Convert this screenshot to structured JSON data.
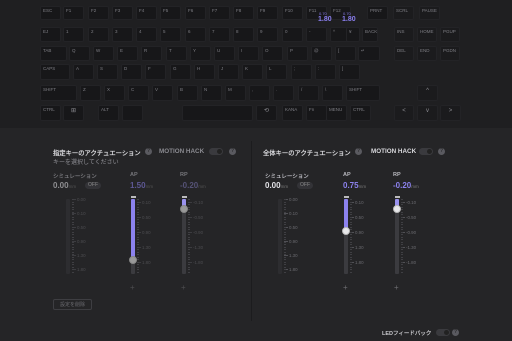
{
  "keyboard": {
    "rows": [
      [
        [
          "ESC",
          0
        ],
        [
          "F1",
          0
        ],
        [
          "F2",
          0
        ],
        [
          "F3",
          0
        ],
        [
          "F4",
          0
        ],
        [
          "F5",
          0
        ],
        [
          "F6",
          0
        ],
        [
          "F7",
          0
        ],
        [
          "F8",
          0
        ],
        [
          "F9",
          0
        ],
        [
          "F10",
          0
        ],
        [
          "F11",
          0
        ],
        [
          "F12",
          0
        ],
        [
          "PRNT",
          0
        ],
        [
          "SCRL",
          0
        ],
        [
          "PAUSE",
          0
        ]
      ],
      [
        [
          "EJ",
          0
        ],
        [
          "1",
          0
        ],
        [
          "2",
          0
        ],
        [
          "3",
          0
        ],
        [
          "4",
          0
        ],
        [
          "5",
          0
        ],
        [
          "6",
          0
        ],
        [
          "7",
          0
        ],
        [
          "8",
          0
        ],
        [
          "9",
          0
        ],
        [
          "0",
          0
        ],
        [
          "-",
          0
        ],
        [
          "^",
          0
        ],
        [
          "¥",
          0
        ],
        [
          "BACK",
          0
        ],
        [
          "INS",
          0
        ],
        [
          "HOME",
          0
        ],
        [
          "PGUP",
          0
        ]
      ],
      [
        [
          "TAB",
          0
        ],
        [
          "Q",
          0
        ],
        [
          "W",
          0
        ],
        [
          "E",
          0
        ],
        [
          "R",
          0
        ],
        [
          "T",
          0
        ],
        [
          "Y",
          0
        ],
        [
          "U",
          0
        ],
        [
          "I",
          0
        ],
        [
          "O",
          0
        ],
        [
          "P",
          0
        ],
        [
          "@",
          0
        ],
        [
          "[",
          0
        ],
        [
          "↵",
          0
        ],
        [
          "DEL",
          0
        ],
        [
          "END",
          0
        ],
        [
          "PGDN",
          0
        ]
      ],
      [
        [
          "CAPS",
          0
        ],
        [
          "A",
          0
        ],
        [
          "S",
          0
        ],
        [
          "D",
          0
        ],
        [
          "F",
          0
        ],
        [
          "G",
          0
        ],
        [
          "H",
          0
        ],
        [
          "J",
          0
        ],
        [
          "K",
          0
        ],
        [
          "L",
          0
        ],
        [
          ";",
          0
        ],
        [
          ":",
          0
        ],
        [
          "]",
          0
        ]
      ],
      [
        [
          "SHIFT",
          0
        ],
        [
          "Z",
          0
        ],
        [
          "X",
          0
        ],
        [
          "C",
          0
        ],
        [
          "V",
          0
        ],
        [
          "B",
          0
        ],
        [
          "N",
          0
        ],
        [
          "M",
          0
        ],
        [
          ",",
          0
        ],
        [
          ".",
          0
        ],
        [
          "/",
          0
        ],
        [
          "\\",
          0
        ],
        [
          "SHIFT",
          0
        ],
        [
          "^",
          1
        ]
      ],
      [
        [
          "CTRL",
          0
        ],
        [
          "⊞",
          1
        ],
        [
          "ALT",
          0
        ],
        [
          "",
          0
        ],
        [
          "",
          0
        ],
        [
          "⟲",
          1
        ],
        [
          "KANA",
          0
        ],
        [
          "Fn",
          0
        ],
        [
          "MENU",
          0
        ],
        [
          "CTRL",
          0
        ],
        [
          "<",
          1
        ],
        [
          "v",
          1
        ],
        [
          ">",
          1
        ]
      ]
    ],
    "fkey_values": [
      {
        "top": "0.70",
        "main": "1.80"
      },
      {
        "top": "0.70",
        "main": "1.80"
      }
    ]
  },
  "panels": [
    {
      "title": "指定キーのアクチュエーション",
      "subtitle": "キーを選択してください",
      "motion_hack": "MOTION HACK",
      "sim_label": "シミュレーション",
      "sim_value": "0.00",
      "sim_unit": "mm",
      "sim_state": "OFF",
      "ap_label": "AP",
      "ap_value": "1.50",
      "ap_unit": "mm",
      "rp_label": "RP",
      "rp_value": "-0.20",
      "rp_unit": "mm",
      "ticks": [
        "0.00",
        "0.10",
        "0.50",
        "0.90",
        "1.30",
        "1.80"
      ],
      "ap_ticks": [
        "0.10",
        "0.50",
        "0.90",
        "1.30",
        "1.80"
      ],
      "rp_ticks": [
        "-0.10",
        "-0.50",
        "-0.90",
        "-1.30",
        "-1.80"
      ],
      "delete_label": "設定を削除",
      "enabled": false,
      "ap_fraction": 0.82,
      "rp_fraction": 0.13
    },
    {
      "title": "全体キーのアクチュエーション",
      "subtitle": "",
      "motion_hack": "MOTION HACK",
      "sim_label": "シミュレーション",
      "sim_value": "0.00",
      "sim_unit": "mm",
      "sim_state": "OFF",
      "ap_label": "AP",
      "ap_value": "0.75",
      "ap_unit": "mm",
      "rp_label": "RP",
      "rp_value": "-0.20",
      "rp_unit": "mm",
      "ticks": [
        "0.00",
        "0.10",
        "0.50",
        "0.90",
        "1.30",
        "1.80"
      ],
      "ap_ticks": [
        "0.10",
        "0.50",
        "0.90",
        "1.30",
        "1.80"
      ],
      "rp_ticks": [
        "-0.10",
        "-0.50",
        "-0.90",
        "-1.30",
        "-1.80"
      ],
      "delete_label": "",
      "enabled": true,
      "ap_fraction": 0.42,
      "rp_fraction": 0.13
    }
  ],
  "footer": {
    "led_label": "LEDフィードバック"
  },
  "colors": {
    "accent": "#8c82ee",
    "bg": "#252527",
    "keyboard_bg": "#1f1f21"
  }
}
